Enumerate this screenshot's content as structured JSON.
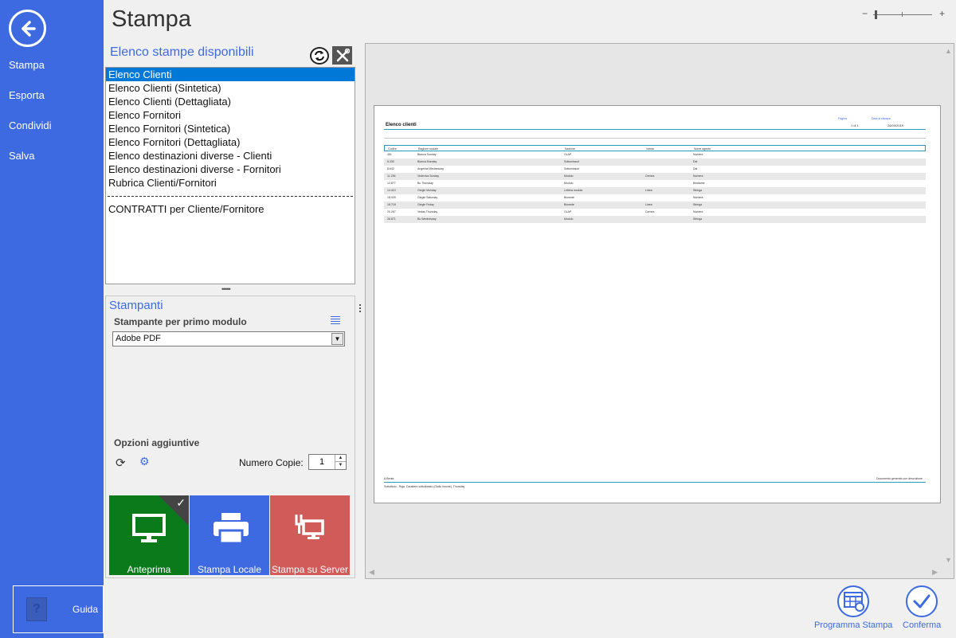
{
  "nav": {
    "items": [
      {
        "label": "Stampa"
      },
      {
        "label": "Esporta"
      },
      {
        "label": "Condividi"
      },
      {
        "label": "Salva"
      }
    ],
    "guide_label": "Guida"
  },
  "page_title": "Stampa",
  "zoom": {
    "minus": "−",
    "plus": "+"
  },
  "reports": {
    "title": "Elenco stampe disponibili",
    "items": [
      "Elenco Clienti",
      "Elenco Clienti (Sintetica)",
      "Elenco Clienti (Dettagliata)",
      "Elenco Fornitori",
      "Elenco Fornitori (Sintetica)",
      "Elenco Fornitori (Dettagliata)",
      "Elenco destinazioni diverse - Clienti",
      "Elenco destinazioni diverse - Fornitori",
      "Rubrica Clienti/Fornitori"
    ],
    "extra_item": "CONTRATTI per Cliente/Fornitore",
    "selected_index": 0
  },
  "printers": {
    "title": "Stampanti",
    "first_module_label": "Stampante per primo modulo",
    "selected_printer": "Adobe PDF",
    "options_label": "Opzioni aggiuntive",
    "copies_label": "Numero Copie:",
    "copies_value": "1"
  },
  "tiles": {
    "preview": {
      "label": "Anteprima",
      "color": "#0a7a1a",
      "checkmark": "✓"
    },
    "local": {
      "label": "Stampa Locale",
      "color": "#3d6ae0"
    },
    "server": {
      "label": "Stampa su Server",
      "color": "#d15b58"
    }
  },
  "preview_page": {
    "title": "Elenco clienti",
    "page_label": "Pagina",
    "date_label": "Data di stampa",
    "page_value": "1 di 1",
    "date_value": "26/03/2019",
    "columns": [
      "Codice",
      "Ragione sociale",
      "Nazione",
      "Valuta",
      "Nome agente"
    ],
    "rows": [
      [
        "451",
        "Bianca Sunday",
        "GLAP",
        "",
        "Numera"
      ],
      [
        "6.330",
        "Bianca Monday",
        "Sottomissori",
        "",
        "Dal"
      ],
      [
        "8.642",
        "Angelina Wednesday",
        "Sottomissori",
        "",
        "Dal"
      ],
      [
        "11.236",
        "Vedeviva Sunday",
        "Modulo",
        "Cemea",
        "Numera"
      ],
      [
        "12.877",
        "Bu Thursday",
        "Modulo",
        "",
        "Bestiame"
      ],
      [
        "14.410",
        "Gingle Monday",
        "Lettera modulo",
        "Linea",
        "Stringa"
      ],
      [
        "18.439",
        "Gingle Saturday",
        "Bionede",
        "",
        "Numera"
      ],
      [
        "18.718",
        "Gingle Friday",
        "Bionede",
        "Linea",
        "Stringa"
      ],
      [
        "20.267",
        "Vedas Thursday",
        "GLAP",
        "Cemea",
        "Numera"
      ],
      [
        "26.871",
        "Bu Wednesday",
        "Modulo",
        "",
        "Stringa"
      ]
    ],
    "footer_left": "A.Bente",
    "footer_right": "Documento generato con descrizione",
    "footer_note": "Sottotitolo - Riga. Carattere sottolineato (Giallo limone), Thursday"
  },
  "bottom_actions": {
    "schedule_label": "Programma Stampa",
    "confirm_label": "Conferma"
  }
}
